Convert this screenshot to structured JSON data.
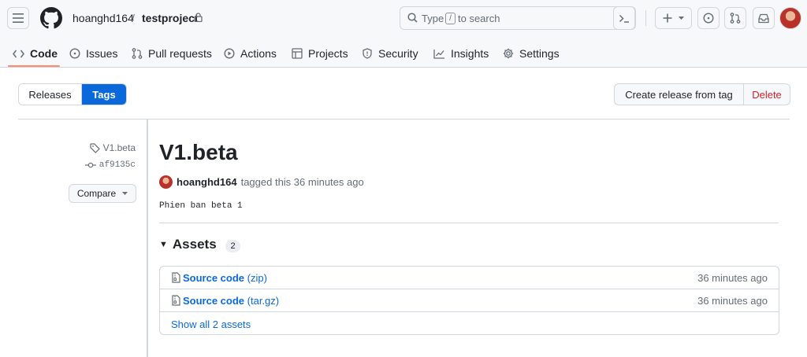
{
  "header": {
    "owner": "hoanghd164",
    "separator": "/",
    "repo": "testproject",
    "search": {
      "prefix": "Type",
      "key": "/",
      "suffix": "to search"
    }
  },
  "nav": {
    "tabs": [
      {
        "label": "Code",
        "icon": "code-icon"
      },
      {
        "label": "Issues",
        "icon": "issue-icon"
      },
      {
        "label": "Pull requests",
        "icon": "pull-request-icon"
      },
      {
        "label": "Actions",
        "icon": "play-icon"
      },
      {
        "label": "Projects",
        "icon": "table-icon"
      },
      {
        "label": "Security",
        "icon": "shield-icon"
      },
      {
        "label": "Insights",
        "icon": "graph-icon"
      },
      {
        "label": "Settings",
        "icon": "gear-icon"
      }
    ]
  },
  "toolbar": {
    "releases_label": "Releases",
    "tags_label": "Tags",
    "create_label": "Create release from tag",
    "delete_label": "Delete"
  },
  "sidebar": {
    "tag": "V1.beta",
    "commit": "af9135c",
    "compare_label": "Compare"
  },
  "release": {
    "title": "V1.beta",
    "author": "hoanghd164",
    "action": "tagged this 36 minutes ago",
    "body": "Phien ban beta 1",
    "assets_label": "Assets",
    "assets_count": "2",
    "assets": [
      {
        "name": "Source code",
        "ext": "(zip)",
        "time": "36 minutes ago"
      },
      {
        "name": "Source code",
        "ext": "(tar.gz)",
        "time": "36 minutes ago"
      }
    ],
    "show_all_label": "Show all 2 assets"
  },
  "colors": {
    "accent": "#0969da",
    "danger": "#cf222e",
    "tab_underline": "#fd8c73"
  }
}
